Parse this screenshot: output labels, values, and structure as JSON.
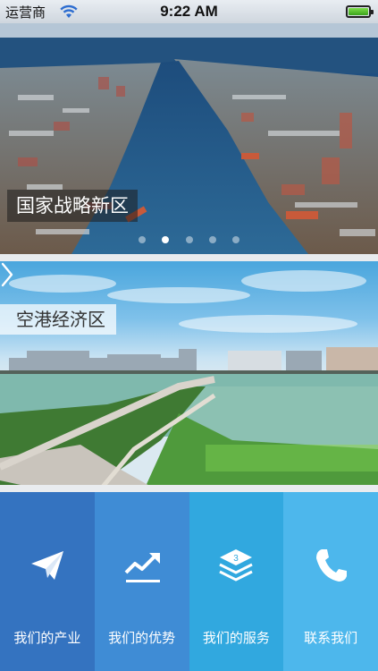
{
  "status_bar": {
    "carrier": "运营商",
    "time": "9:22 AM",
    "wifi_icon": "wifi-icon",
    "battery_icon": "battery-icon",
    "battery_level": 1.0
  },
  "banner_top": {
    "label": "国家战略新区",
    "page_count": 5,
    "active_page": 2
  },
  "banner_mid": {
    "label": "空港经济区",
    "next_icon": "chevron-right-icon"
  },
  "menu": {
    "items": [
      {
        "label": "我们的产业",
        "icon": "paper-plane-icon",
        "color": "#3473c0"
      },
      {
        "label": "我们的优势",
        "icon": "trend-up-icon",
        "color": "#3f8cd5"
      },
      {
        "label": "我们的服务",
        "icon": "layers-icon",
        "badge": "3",
        "color": "#31a8df"
      },
      {
        "label": "联系我们",
        "icon": "phone-icon",
        "color": "#4db7ec"
      }
    ]
  }
}
